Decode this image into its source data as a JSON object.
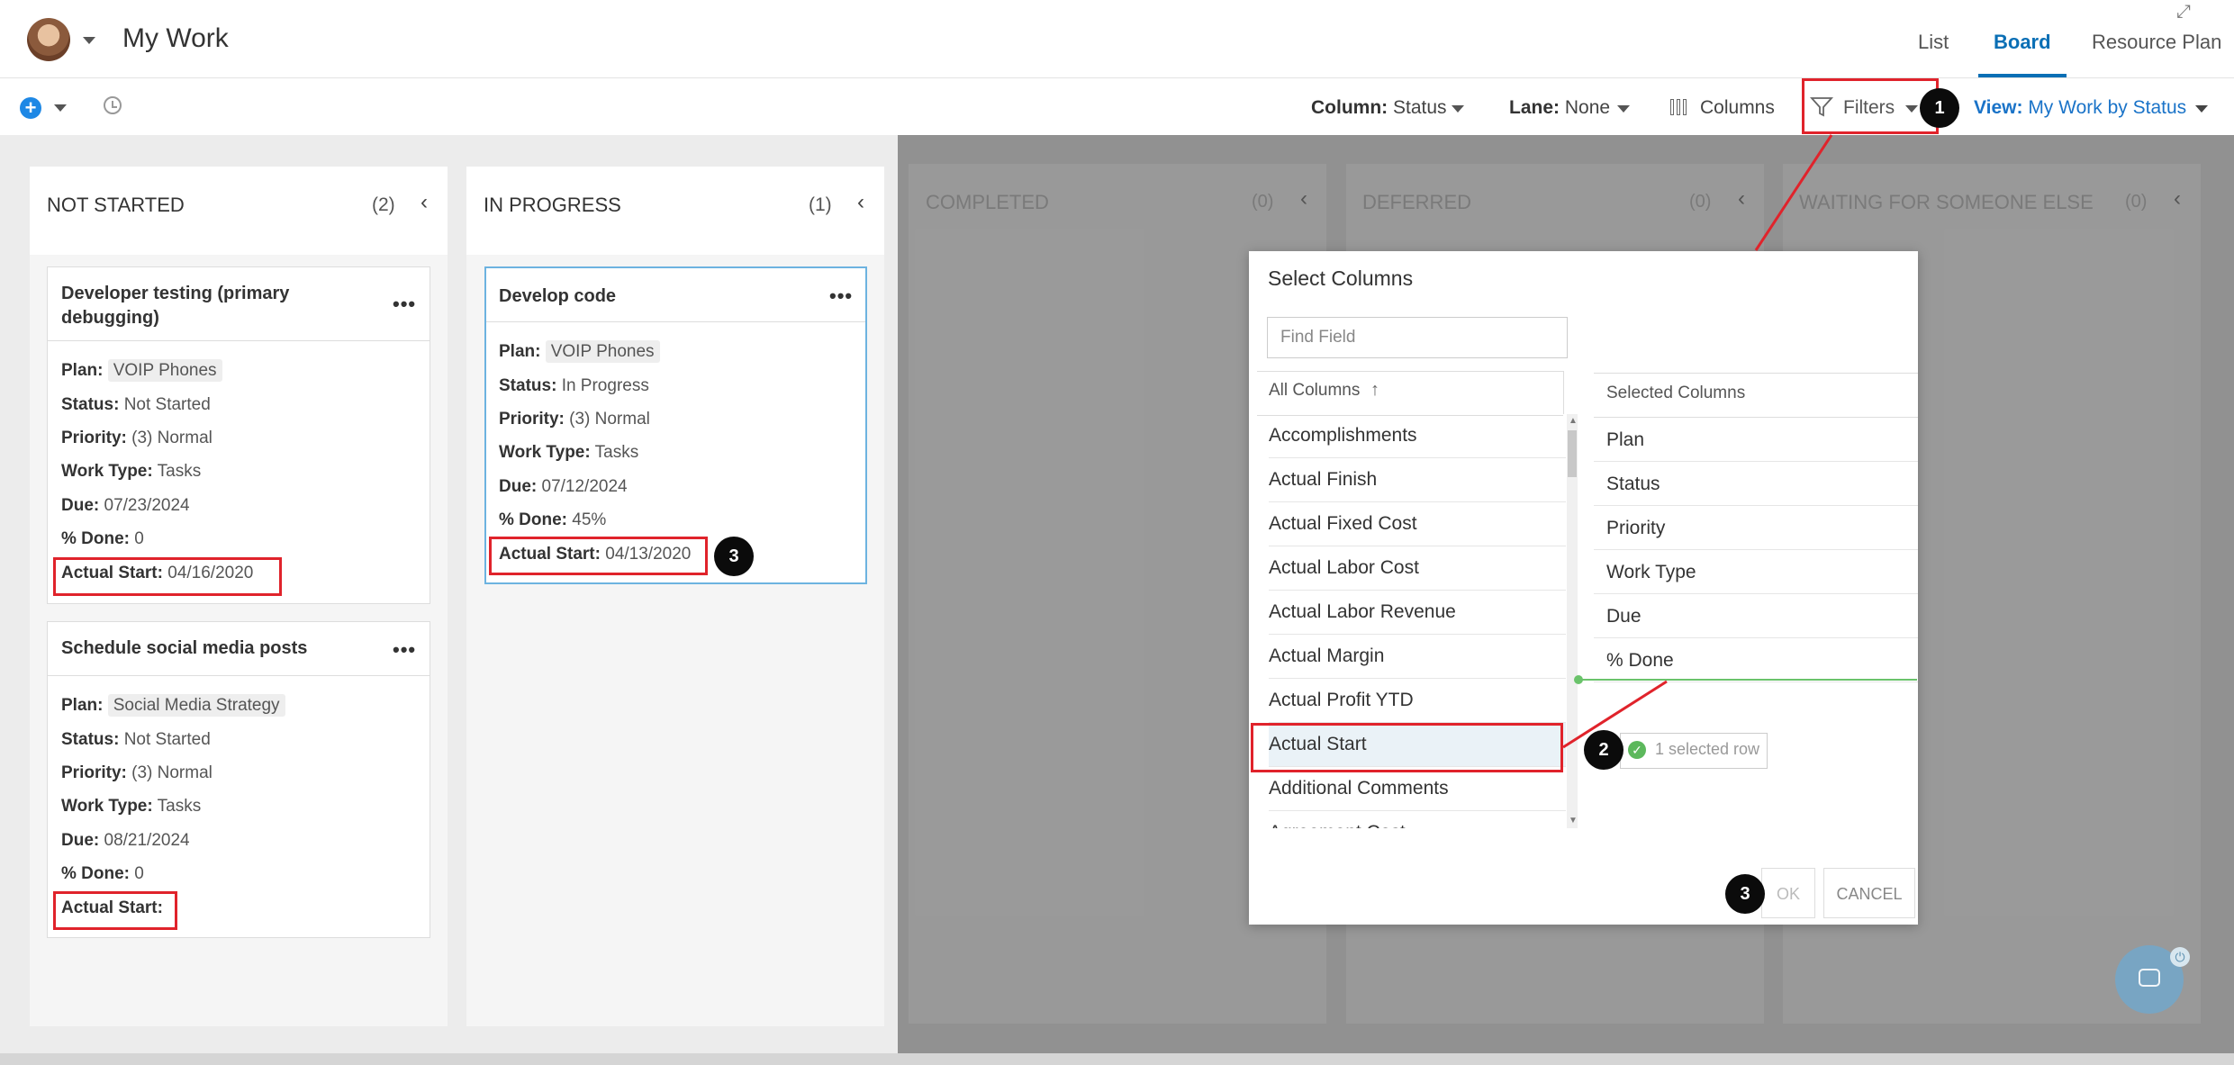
{
  "header": {
    "title": "My Work",
    "tabs": [
      {
        "label": "List"
      },
      {
        "label": "Board"
      },
      {
        "label": "Resource Plan"
      }
    ]
  },
  "toolbar": {
    "column_label": "Column:",
    "column_value": "Status",
    "lane_label": "Lane:",
    "lane_value": "None",
    "columns_label": "Columns",
    "filters_label": "Filters",
    "view_label": "View:",
    "view_value": "My Work by Status"
  },
  "lanes": [
    {
      "name": "NOT STARTED",
      "count": "(2)"
    },
    {
      "name": "IN PROGRESS",
      "count": "(1)"
    },
    {
      "name": "COMPLETED",
      "count": "(0)"
    },
    {
      "name": "DEFERRED",
      "count": "(0)"
    },
    {
      "name": "WAITING FOR SOMEONE ELSE",
      "count": "(0)"
    }
  ],
  "labels": {
    "plan": "Plan:",
    "status": "Status:",
    "priority": "Priority:",
    "work_type": "Work Type:",
    "due": "Due:",
    "done": "% Done:",
    "actual_start": "Actual Start:"
  },
  "cards": [
    {
      "title_line1": "Developer testing (primary",
      "title_line2": "debugging)",
      "plan": "VOIP Phones",
      "status": "Not Started",
      "priority": "(3) Normal",
      "work_type": "Tasks",
      "due": "07/23/2024",
      "done": "0",
      "actual_start": "04/16/2020"
    },
    {
      "title_line1": "Schedule social media posts",
      "plan": "Social Media Strategy",
      "status": "Not Started",
      "priority": "(3) Normal",
      "work_type": "Tasks",
      "due": "08/21/2024",
      "done": "0",
      "actual_start": ""
    },
    {
      "title_line1": "Develop code",
      "plan": "VOIP Phones",
      "status": "In Progress",
      "priority": "(3) Normal",
      "work_type": "Tasks",
      "due": "07/12/2024",
      "done": "45%",
      "actual_start": "04/13/2020"
    }
  ],
  "dialog": {
    "title": "Select Columns",
    "find_placeholder": "Find Field",
    "all_columns_label": "All Columns",
    "selected_columns_label": "Selected Columns",
    "all_columns": [
      "Accomplishments",
      "Actual Finish",
      "Actual Fixed Cost",
      "Actual Labor Cost",
      "Actual Labor Revenue",
      "Actual Margin",
      "Actual Profit YTD",
      "Actual Start",
      "Additional Comments",
      "Agreement Cost"
    ],
    "selected_columns": [
      "Plan",
      "Status",
      "Priority",
      "Work Type",
      "Due",
      "% Done"
    ],
    "selected_row_text": "1 selected row",
    "ok_label": "OK",
    "cancel_label": "CANCEL"
  },
  "annotations": {
    "step1": "1",
    "step2": "2",
    "step3a": "3",
    "step3b": "3",
    "accent_color": "#e0232b",
    "brand_color": "#0a6fb5"
  }
}
